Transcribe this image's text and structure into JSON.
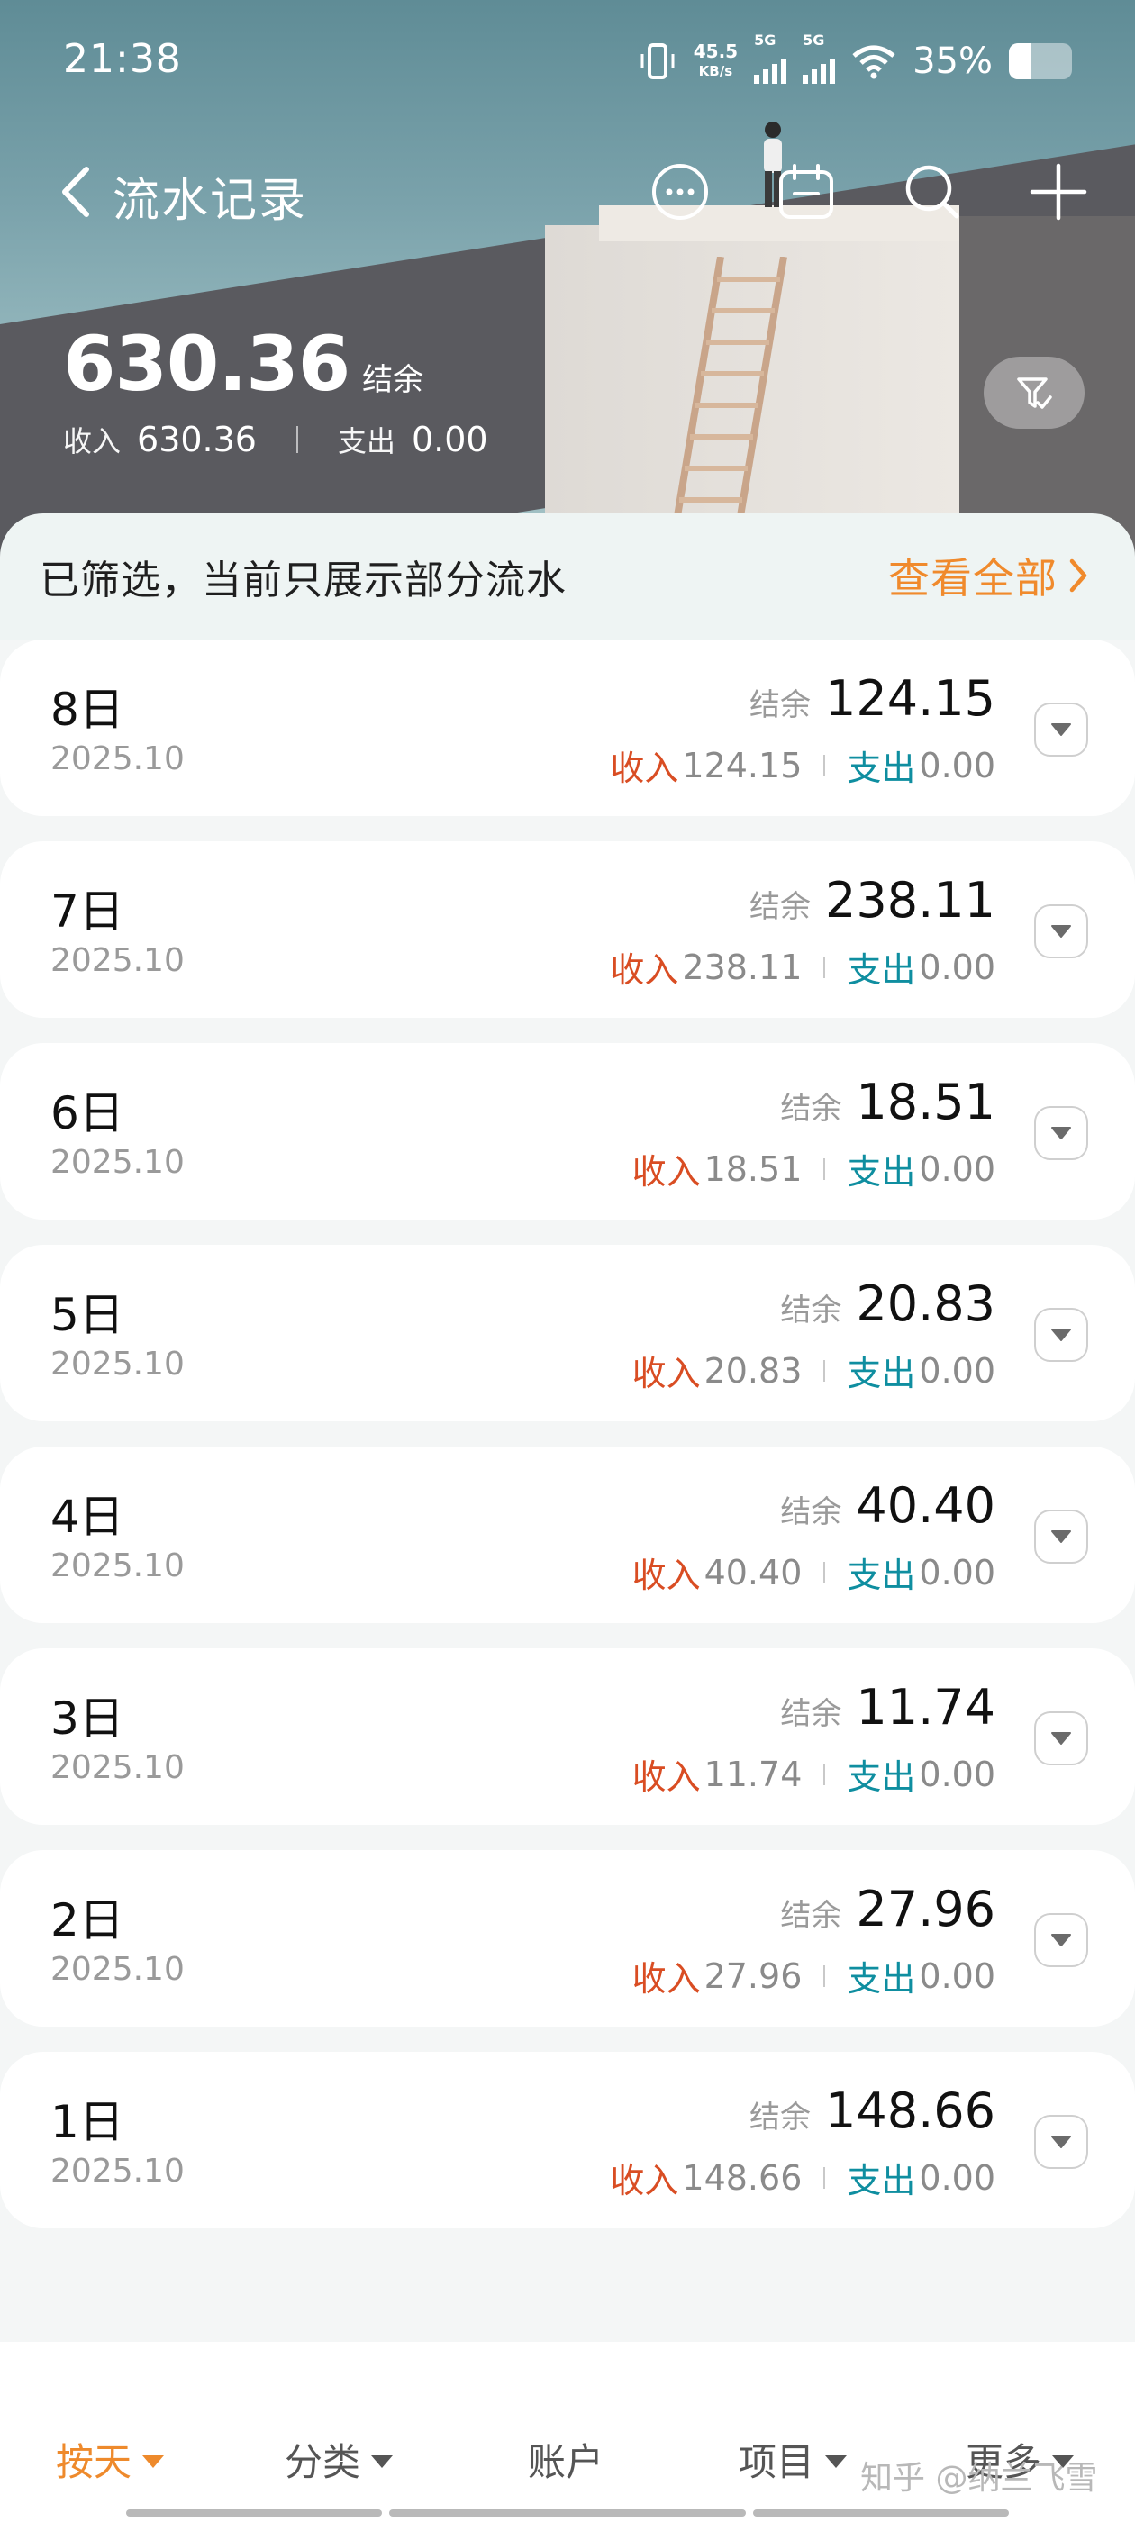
{
  "status_bar": {
    "time": "21:38",
    "net_speed_value": "45.5",
    "net_speed_unit": "KB/s",
    "signal1_label": "5G",
    "signal2_label": "5G",
    "battery_pct": "35%"
  },
  "nav": {
    "title": "流水记录",
    "icons": [
      "back-icon",
      "more-icon",
      "calendar-icon",
      "search-icon",
      "add-icon"
    ]
  },
  "summary": {
    "balance": "630.36",
    "balance_label": "结余",
    "income_label": "收入",
    "income": "630.36",
    "expense_label": "支出",
    "expense": "0.00"
  },
  "banner": {
    "text": "已筛选，当前只展示部分流水",
    "link": "查看全部"
  },
  "days": [
    {
      "day": "8日",
      "month": "2025.10",
      "balance_label": "结余",
      "balance": "124.15",
      "income_label": "收入",
      "income": "124.15",
      "expense_label": "支出",
      "expense": "0.00"
    },
    {
      "day": "7日",
      "month": "2025.10",
      "balance_label": "结余",
      "balance": "238.11",
      "income_label": "收入",
      "income": "238.11",
      "expense_label": "支出",
      "expense": "0.00"
    },
    {
      "day": "6日",
      "month": "2025.10",
      "balance_label": "结余",
      "balance": "18.51",
      "income_label": "收入",
      "income": "18.51",
      "expense_label": "支出",
      "expense": "0.00"
    },
    {
      "day": "5日",
      "month": "2025.10",
      "balance_label": "结余",
      "balance": "20.83",
      "income_label": "收入",
      "income": "20.83",
      "expense_label": "支出",
      "expense": "0.00"
    },
    {
      "day": "4日",
      "month": "2025.10",
      "balance_label": "结余",
      "balance": "40.40",
      "income_label": "收入",
      "income": "40.40",
      "expense_label": "支出",
      "expense": "0.00"
    },
    {
      "day": "3日",
      "month": "2025.10",
      "balance_label": "结余",
      "balance": "11.74",
      "income_label": "收入",
      "income": "11.74",
      "expense_label": "支出",
      "expense": "0.00"
    },
    {
      "day": "2日",
      "month": "2025.10",
      "balance_label": "结余",
      "balance": "27.96",
      "income_label": "收入",
      "income": "27.96",
      "expense_label": "支出",
      "expense": "0.00"
    },
    {
      "day": "1日",
      "month": "2025.10",
      "balance_label": "结余",
      "balance": "148.66",
      "income_label": "收入",
      "income": "148.66",
      "expense_label": "支出",
      "expense": "0.00"
    }
  ],
  "tabs": [
    {
      "label": "按天",
      "dropdown": true,
      "active": true
    },
    {
      "label": "分类",
      "dropdown": true,
      "active": false
    },
    {
      "label": "账户",
      "dropdown": false,
      "active": false
    },
    {
      "label": "项目",
      "dropdown": true,
      "active": false
    },
    {
      "label": "更多",
      "dropdown": true,
      "active": false
    }
  ],
  "watermark": "知乎 @纳兰飞雪",
  "colors": {
    "accent": "#f08a2c",
    "income": "#d94d23",
    "expense": "#0f8ea0"
  }
}
